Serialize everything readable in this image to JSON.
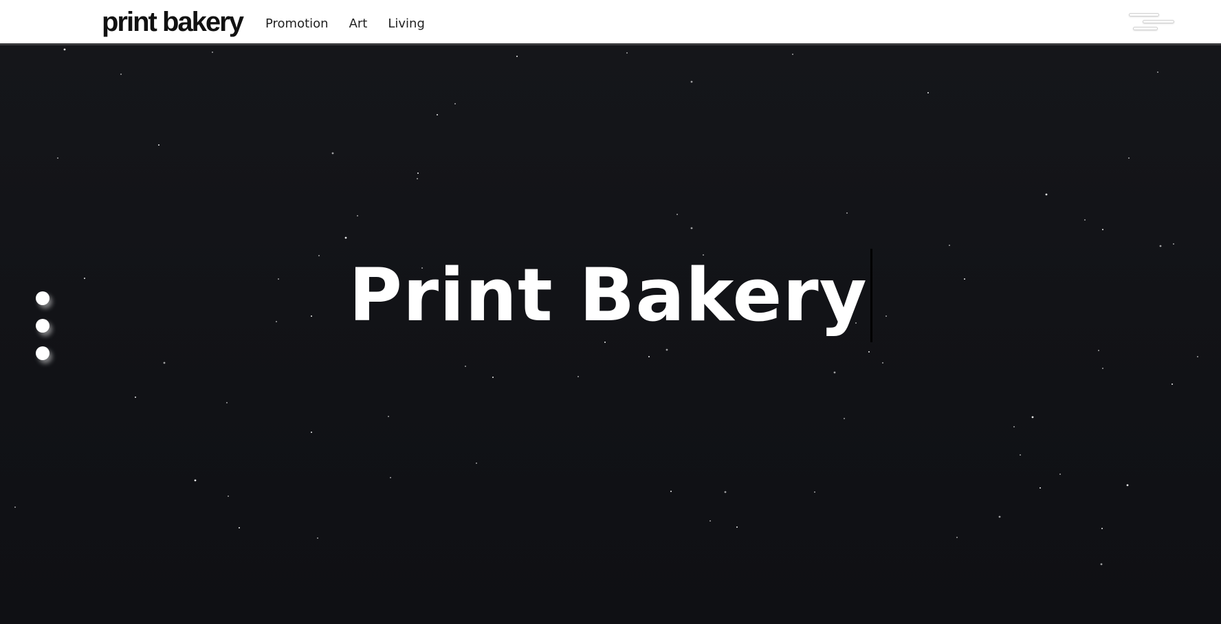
{
  "header": {
    "logo_text": "print bakery",
    "nav": [
      {
        "label": "Promotion"
      },
      {
        "label": "Art"
      },
      {
        "label": "Living"
      }
    ],
    "menu_icon": "hamburger-menu-icon"
  },
  "hero": {
    "title": "Print Bakery",
    "background_color": "#121318",
    "star_color": "#ffffff"
  },
  "side_nav": {
    "dots": 3,
    "dot_color": "#ffffff"
  },
  "colors": {
    "header_bg": "#ffffff",
    "header_border": "#3a3a3c",
    "text_dark": "#111111"
  }
}
